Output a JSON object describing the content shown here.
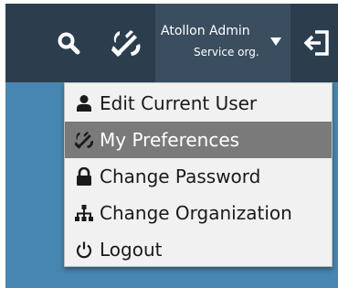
{
  "header": {
    "user_name": "Atollon Admin",
    "user_org": "Service org.",
    "icons": {
      "search": "search-icon",
      "preferences": "wrench-icon",
      "dropdown": "caret-down-icon",
      "logout": "logout-icon"
    },
    "colors": {
      "bar": "#2c3e4e",
      "user_button": "#3a4e5f",
      "background": "#4786b0"
    }
  },
  "menu": {
    "items": [
      {
        "label": "Edit Current User",
        "icon": "user-icon",
        "active": false
      },
      {
        "label": "My Preferences",
        "icon": "wrench-icon",
        "active": true
      },
      {
        "label": "Change Password",
        "icon": "lock-icon",
        "active": false
      },
      {
        "label": "Change Organization",
        "icon": "sitemap-icon",
        "active": false
      },
      {
        "label": "Logout",
        "icon": "power-icon",
        "active": false
      }
    ],
    "colors": {
      "background": "#f1f1f1",
      "active": "#7a7a7a"
    }
  }
}
